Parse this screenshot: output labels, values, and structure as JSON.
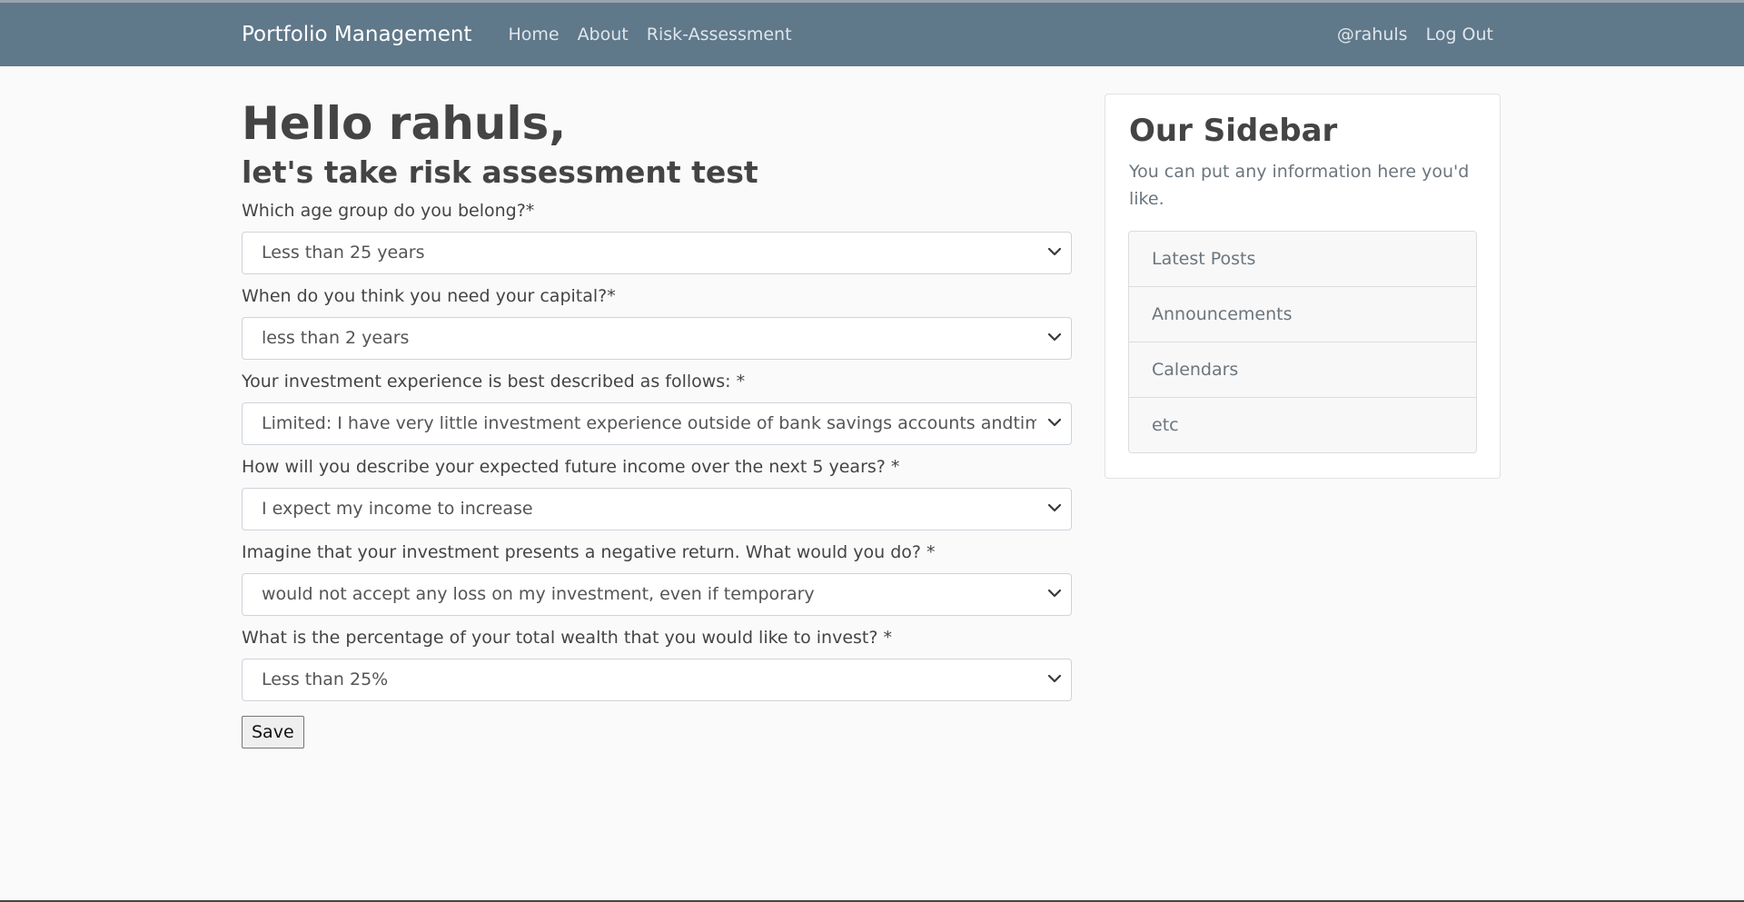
{
  "navbar": {
    "brand": "Portfolio Management",
    "links": [
      {
        "label": "Home"
      },
      {
        "label": "About"
      },
      {
        "label": "Risk-Assessment"
      }
    ],
    "user": "@rahuls",
    "logout": "Log Out"
  },
  "main": {
    "greeting": "Hello rahuls,",
    "subtitle": "let's take risk assessment test",
    "questions": [
      {
        "label": "Which age group do you belong?*",
        "value": "Less than 25 years"
      },
      {
        "label": "When do you think you need your capital?*",
        "value": "less than 2 years"
      },
      {
        "label": "Your investment experience is best described as follows: *",
        "value": "Limited: I have very little investment experience outside of bank savings accounts andtime deposits"
      },
      {
        "label": "How will you describe your expected future income over the next 5 years? *",
        "value": "I expect my income to increase"
      },
      {
        "label": "Imagine that your investment presents a negative return. What would you do? *",
        "value": "would not accept any loss on my investment, even if temporary"
      },
      {
        "label": "What is the percentage of your total wealth that you would like to invest? *",
        "value": "Less than 25%"
      }
    ],
    "save_label": "Save"
  },
  "sidebar": {
    "title": "Our Sidebar",
    "text": "You can put any information here you'd like.",
    "items": [
      {
        "label": "Latest Posts"
      },
      {
        "label": "Announcements"
      },
      {
        "label": "Calendars"
      },
      {
        "label": "etc"
      }
    ]
  },
  "colors": {
    "navbar_bg": "#5f788a",
    "page_bg": "#fafafa"
  }
}
